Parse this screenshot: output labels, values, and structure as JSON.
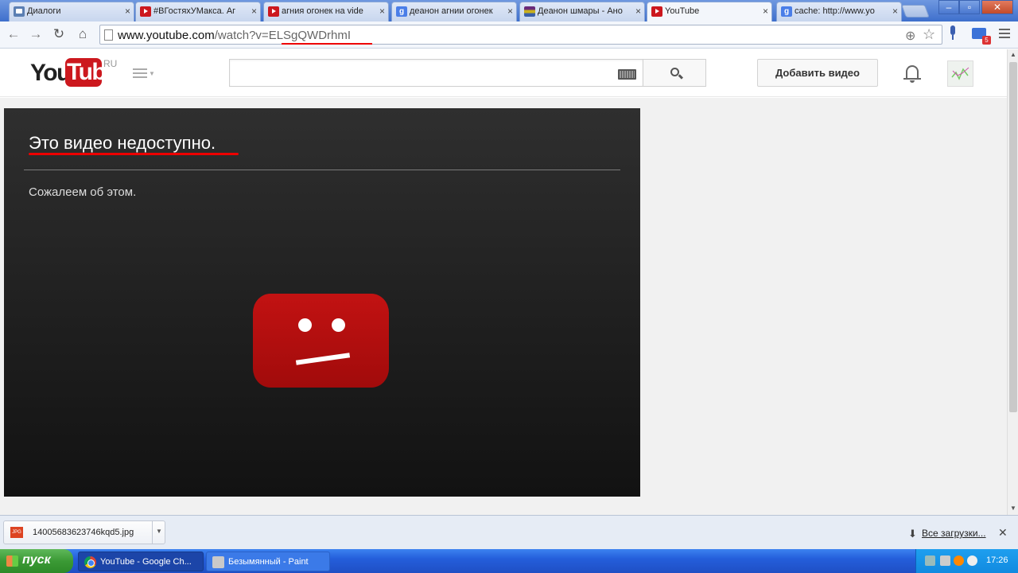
{
  "browser": {
    "tabs": [
      {
        "label": "Диалоги",
        "icon": "vk-messages-icon"
      },
      {
        "label": "#ВГостяхУМакса. Аг",
        "icon": "youtube-icon"
      },
      {
        "label": "агния огонек на vide",
        "icon": "youtube-icon"
      },
      {
        "label": "деанон агнии огонек",
        "icon": "google-icon"
      },
      {
        "label": "Деанон шмары - Ано",
        "icon": "archive-icon"
      },
      {
        "label": "YouTube",
        "icon": "youtube-icon"
      },
      {
        "label": "cache: http://www.yo",
        "icon": "google-icon"
      }
    ],
    "tab_close_glyph": "×",
    "google_glyph": "g",
    "omnibox": {
      "host": "www.youtube.com",
      "path": "/watch?v=ELSgQWDrhmI"
    },
    "mail_badge": "5"
  },
  "youtube": {
    "logo_you": "You",
    "logo_tube": "Tube",
    "logo_region": "RU",
    "search_value": "",
    "upload_label": "Добавить видео",
    "brand_color": "#cc181e"
  },
  "player": {
    "error_title": "Это видео недоступно.",
    "error_subtitle": "Сожалеем об этом."
  },
  "downloads": {
    "file_name": "14005683623746kqd5.jpg",
    "file_type": "JPG",
    "show_all_label": "Все загрузки..."
  },
  "taskbar": {
    "start_label": "пуск",
    "tasks": [
      {
        "label": "YouTube - Google Ch...",
        "icon": "chrome-icon",
        "active": true
      },
      {
        "label": "Безымянный - Paint",
        "icon": "paint-icon",
        "active": false
      }
    ],
    "clock": "17:26"
  }
}
